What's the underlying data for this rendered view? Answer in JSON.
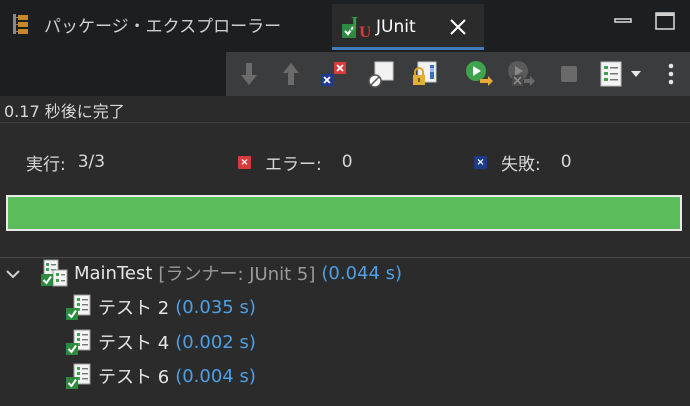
{
  "tabs": {
    "package_explorer": "パッケージ・エクスプローラー",
    "junit": "JUnit"
  },
  "status": "0.17 秒後に完了",
  "counters": {
    "runs_label": "実行:",
    "runs_value": "3/3",
    "errors_label": "エラー:",
    "errors_value": "0",
    "failures_label": "失敗:",
    "failures_value": "0"
  },
  "progress": {
    "fraction": 1.0,
    "color": "#5cbd5c"
  },
  "tree": {
    "root": {
      "name": "MainTest",
      "runner": "[ランナー: JUnit 5]",
      "time": "(0.044 s)"
    },
    "children": [
      {
        "name": "テスト 2",
        "time": "(0.035 s)"
      },
      {
        "name": "テスト 4",
        "time": "(0.002 s)"
      },
      {
        "name": "テスト 6",
        "time": "(0.004 s)"
      }
    ]
  },
  "colors": {
    "accent": "#3f7cb8",
    "pass": "#5cbd5c",
    "time_text": "#4e9fe6",
    "error": "#d83b3b",
    "failure": "#1e3a8a"
  },
  "icons": {
    "package_explorer": "package-explorer-icon",
    "junit": "junit-icon",
    "close": "close-icon",
    "minimize": "minimize-icon",
    "maximize": "maximize-icon",
    "next_failure": "arrow-down-icon",
    "previous_failure": "arrow-up-icon",
    "failures_only": "failures-only-icon",
    "skipped_only": "skipped-only-icon",
    "scroll_lock": "scroll-lock-icon",
    "rerun": "rerun-icon",
    "rerun_failed": "rerun-failed-icon",
    "stop": "stop-icon",
    "history": "history-icon",
    "view_menu": "view-menu-icon",
    "toggle": "chevron-down-icon"
  }
}
